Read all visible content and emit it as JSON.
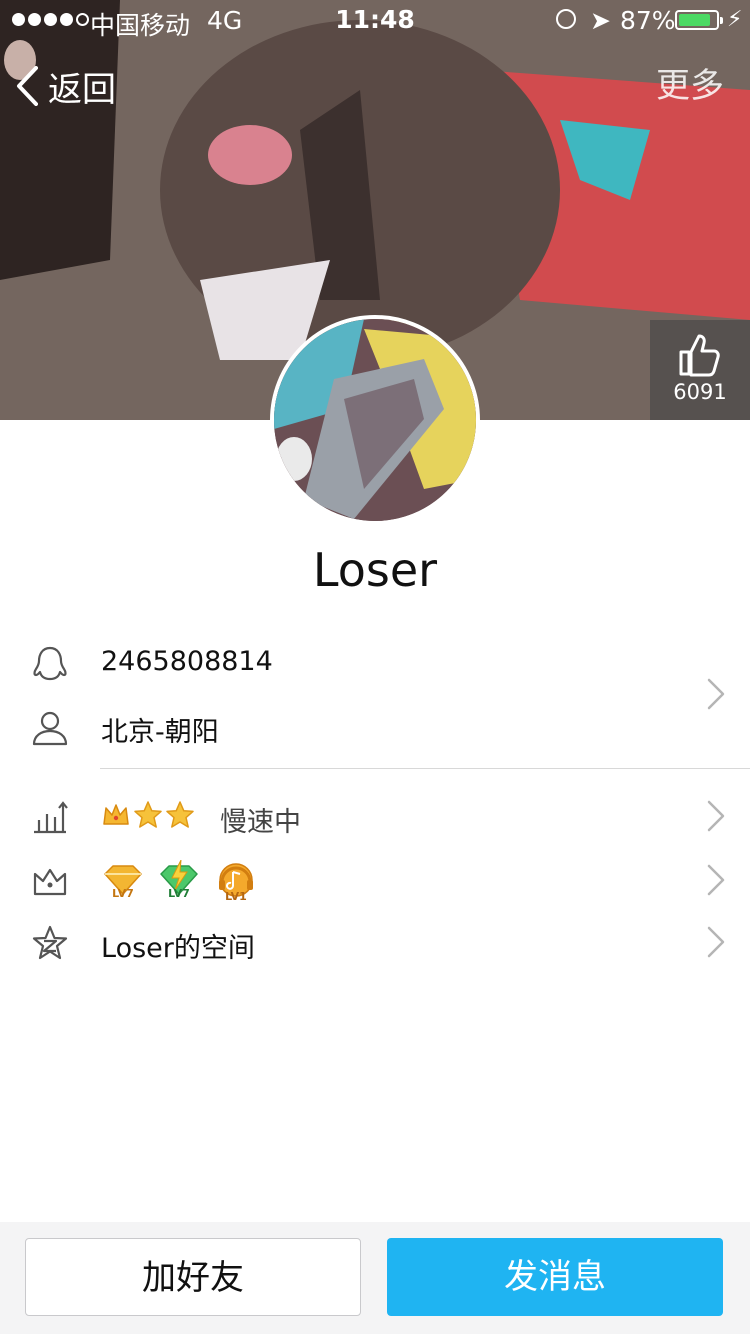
{
  "status_bar": {
    "carrier": "中国移动",
    "network": "4G",
    "time": "11:48",
    "battery_percent": "87%",
    "battery_level": 0.87
  },
  "nav": {
    "back_label": "返回",
    "more_label": "更多"
  },
  "like": {
    "count": "6091"
  },
  "profile": {
    "name": "Loser"
  },
  "info": {
    "qq_number": "2465808814",
    "location": "北京-朝阳",
    "level_status": "慢速中",
    "space_label": "Loser的空间"
  },
  "badges": {
    "vip_level": "LV7",
    "svip_level": "LV7",
    "music_level": "LV1"
  },
  "actions": {
    "add_friend": "加好友",
    "send_message": "发消息"
  },
  "colors": {
    "accent": "#1fb4f2",
    "battery": "#4cd964"
  }
}
